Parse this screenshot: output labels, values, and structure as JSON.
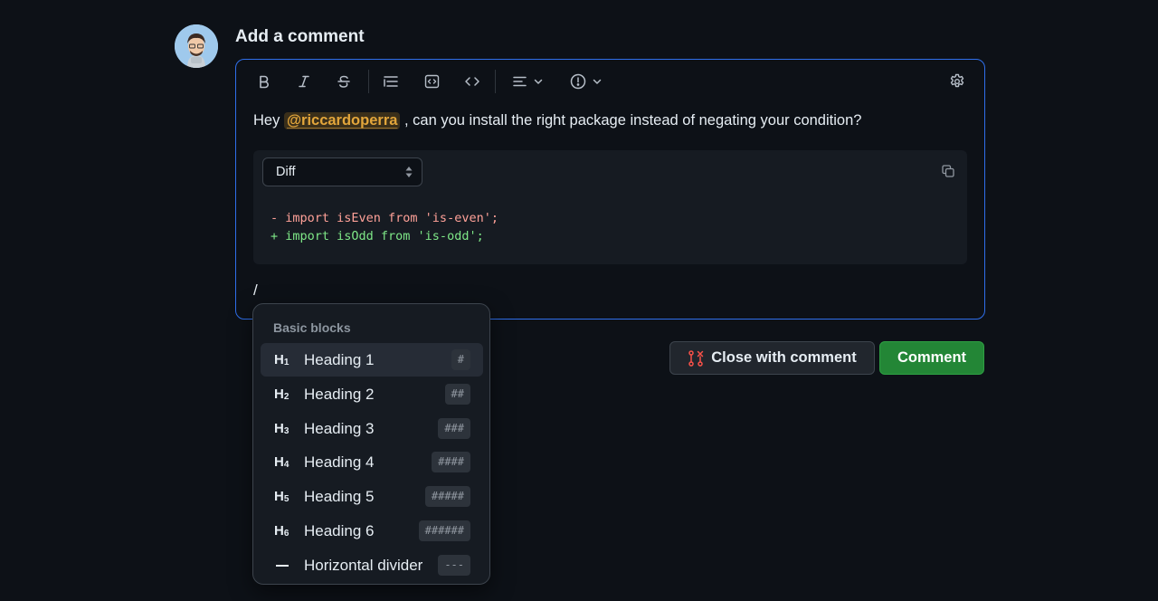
{
  "header": {
    "title": "Add a comment"
  },
  "editor": {
    "toolbar": {
      "icons": [
        "bold-icon",
        "italic-icon",
        "strikethrough-icon",
        "list-icon",
        "code-block-icon",
        "code-icon",
        "align-icon",
        "alert-icon",
        "settings-icon"
      ]
    },
    "text_before": "Hey ",
    "mention": "@riccardoperra",
    "text_after": " , can you install the right package instead of negating your condition?",
    "code_block": {
      "language": "Diff",
      "lines": [
        "- import isEven from 'is-even';",
        "+ import isOdd from 'is-odd';"
      ]
    },
    "slash_text": "/"
  },
  "actions": {
    "close_label": "Close with comment",
    "comment_label": "Comment"
  },
  "slash_menu": {
    "heading": "Basic blocks",
    "items": [
      {
        "icon": "H",
        "sub": "1",
        "label": "Heading 1",
        "shortcut": "#"
      },
      {
        "icon": "H",
        "sub": "2",
        "label": "Heading 2",
        "shortcut": "##"
      },
      {
        "icon": "H",
        "sub": "3",
        "label": "Heading 3",
        "shortcut": "###"
      },
      {
        "icon": "H",
        "sub": "4",
        "label": "Heading 4",
        "shortcut": "####"
      },
      {
        "icon": "H",
        "sub": "5",
        "label": "Heading 5",
        "shortcut": "#####"
      },
      {
        "icon": "H",
        "sub": "6",
        "label": "Heading 6",
        "shortcut": "######"
      },
      {
        "icon": "divider",
        "label": "Horizontal divider",
        "shortcut": "---"
      }
    ]
  },
  "colors": {
    "background": "#0d1117",
    "focus_border": "#2f6feb",
    "mention": "#e3a63b",
    "diff_removed": "#ffa198",
    "diff_added": "#7ee787",
    "primary_button": "#238636",
    "close_icon": "#f85149"
  }
}
